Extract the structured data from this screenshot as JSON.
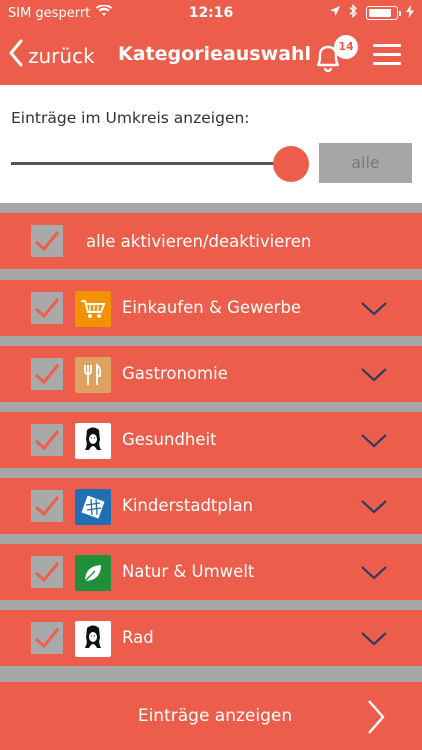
{
  "status_bar": {
    "carrier": "SIM gesperrt",
    "time": "12:16"
  },
  "nav": {
    "back_label": "zurück",
    "title": "Kategorieauswahl",
    "notification_count": "14"
  },
  "radius": {
    "label": "Einträge im Umkreis anzeigen:",
    "button_label": "alle",
    "slider_value_fraction": 1.0
  },
  "toggle_all": {
    "label": "alle aktivieren/deaktivieren",
    "checked": true
  },
  "categories": [
    {
      "label": "Einkaufen & Gewerbe",
      "icon": "shopping-cart-icon",
      "icon_color": "#f39200",
      "checked": true
    },
    {
      "label": "Gastronomie",
      "icon": "fork-knife-icon",
      "icon_color": "#dda160",
      "checked": true
    },
    {
      "label": "Gesundheit",
      "icon": "person-silhouette-icon",
      "icon_color": "#ffffff",
      "checked": true
    },
    {
      "label": "Kinderstadtplan",
      "icon": "city-map-icon",
      "icon_color": "#1f6fb5",
      "checked": true
    },
    {
      "label": "Natur & Umwelt",
      "icon": "leaf-icon",
      "icon_color": "#1f8f3a",
      "checked": true
    },
    {
      "label": "Rad",
      "icon": "person-silhouette-icon",
      "icon_color": "#ffffff",
      "checked": true
    }
  ],
  "footer": {
    "show_entries_label": "Einträge anzeigen"
  },
  "colors": {
    "accent": "#ec5e4b",
    "separator": "#a6a6a6",
    "checkbox": "#aaa9a9",
    "chevron": "#2d3a5e"
  }
}
